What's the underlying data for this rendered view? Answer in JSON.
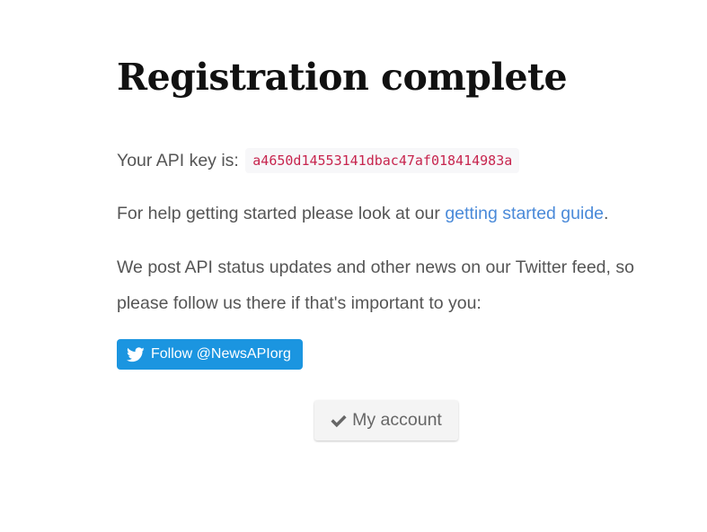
{
  "page": {
    "title": "Registration complete"
  },
  "api_key": {
    "label": "Your API key is:",
    "value": "a4650d14553141dbac47af018414983a"
  },
  "help": {
    "text_before": "For help getting started please look at our ",
    "link_label": "getting started guide",
    "text_after": "."
  },
  "news": {
    "line1": "We post API status updates and other news on our Twitter feed, so",
    "line2": "please follow us there if that's important to you:"
  },
  "twitter_button": {
    "label": "Follow @NewsAPIorg",
    "icon": "twitter-bird-icon",
    "color": "#1b95e0"
  },
  "account_button": {
    "label": "My account",
    "icon": "checkmark-icon"
  },
  "colors": {
    "link": "#4a8ad9",
    "api_key_text": "#c7254e",
    "api_key_bg": "#f7f7f9"
  }
}
